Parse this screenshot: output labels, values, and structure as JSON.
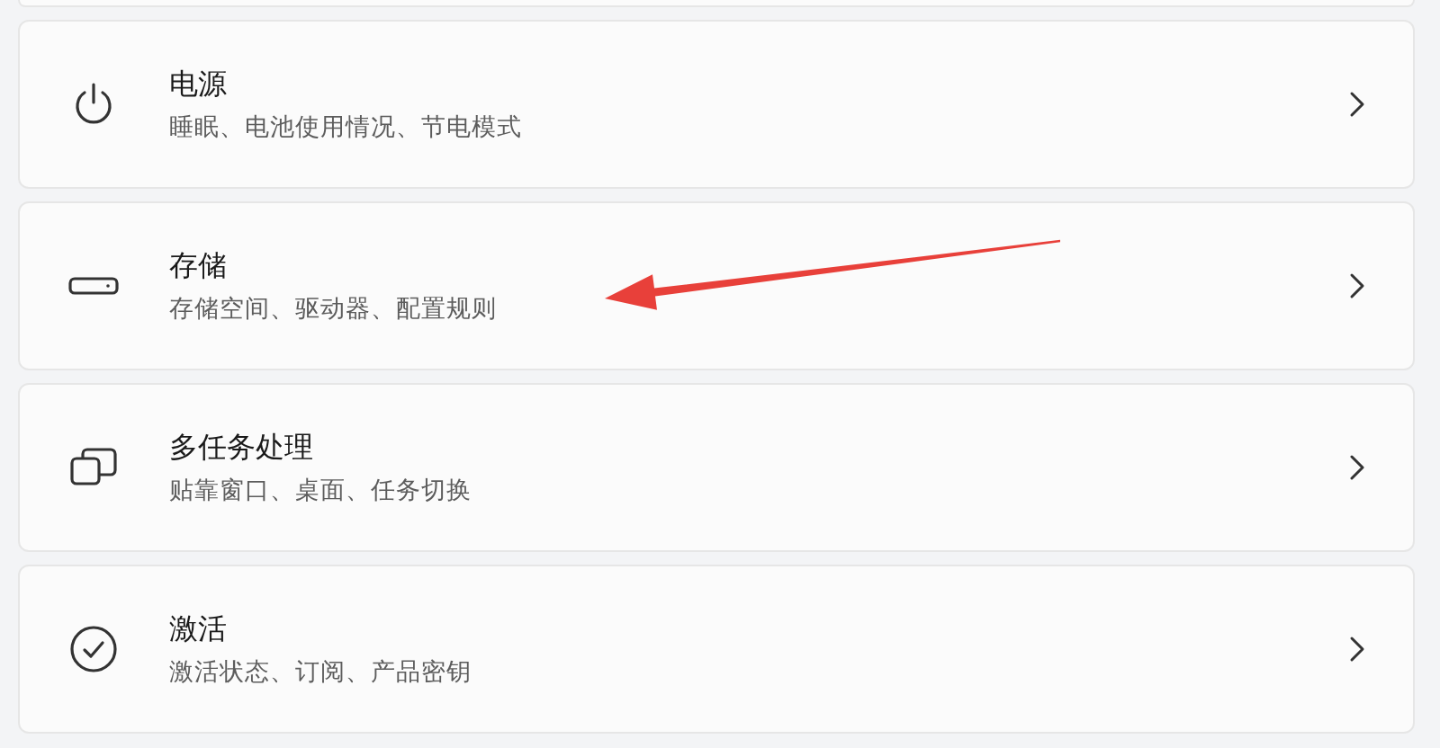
{
  "settings_items": [
    {
      "kind": "power",
      "title": "电源",
      "description": "睡眠、电池使用情况、节电模式",
      "pointed": false
    },
    {
      "kind": "storage",
      "title": "存储",
      "description": "存储空间、驱动器、配置规则",
      "pointed": true
    },
    {
      "kind": "multitask",
      "title": "多任务处理",
      "description": "贴靠窗口、桌面、任务切换",
      "pointed": false
    },
    {
      "kind": "activation",
      "title": "激活",
      "description": "激活状态、订阅、产品密钥",
      "pointed": false
    }
  ]
}
